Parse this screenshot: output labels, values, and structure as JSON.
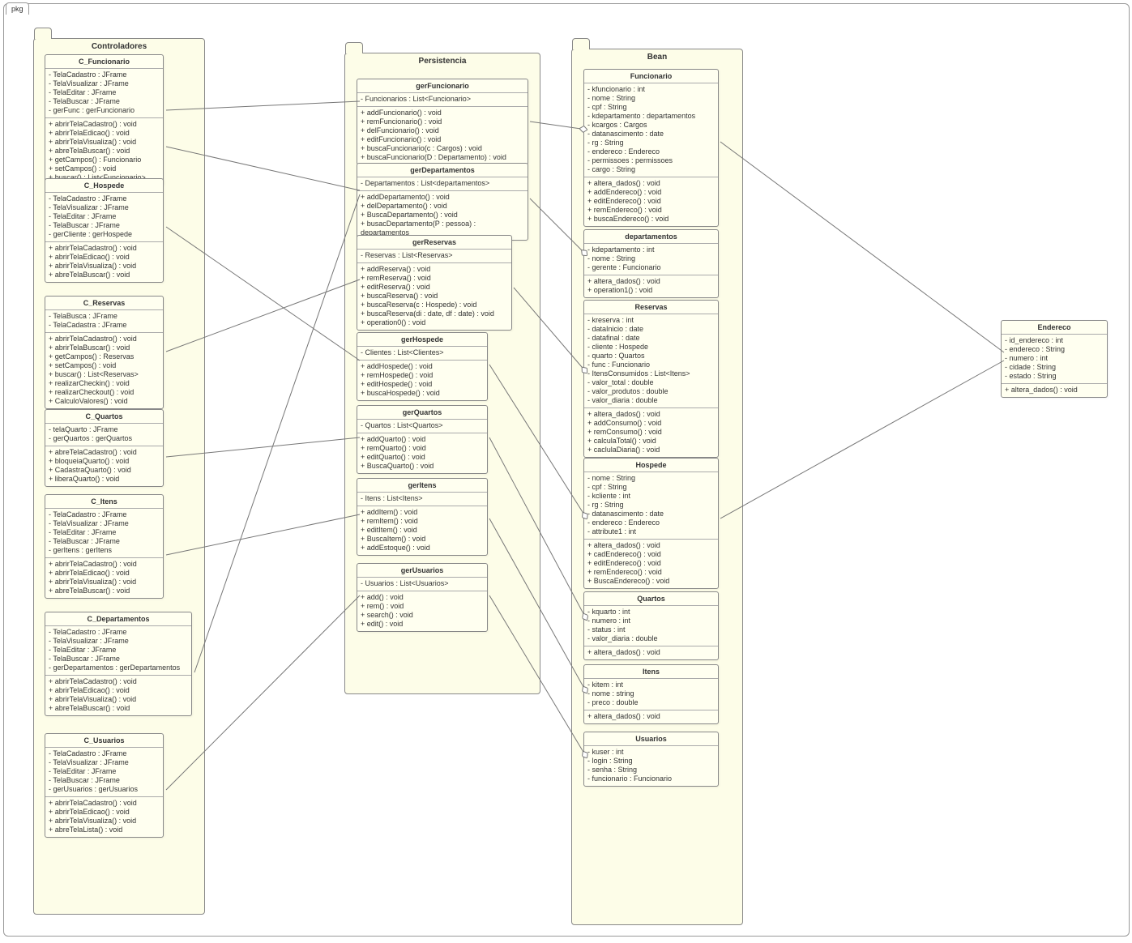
{
  "outer_package_label": "pkg",
  "packages": {
    "controladores": {
      "title": "Controladores"
    },
    "persistencia": {
      "title": "Persistencia"
    },
    "bean": {
      "title": "Bean"
    }
  },
  "classes": {
    "c_funcionario": {
      "name": "C_Funcionario",
      "attrs": [
        "- TelaCadastro : JFrame",
        "- TelaVisualizar : JFrame",
        "- TelaEditar : JFrame",
        "- TelaBuscar : JFrame",
        "- gerFunc : gerFuncionario"
      ],
      "ops": [
        "+ abrirTelaCadastro() : void",
        "+ abrirTelaEdicao() : void",
        "+ abrirTelaVisualiza() : void",
        "+ abreTelaBuscar() : void",
        "+ getCampos() : Funcionario",
        "+ setCampos() : void",
        "+ buscar() : List<Funcionario>"
      ]
    },
    "c_hospede": {
      "name": "C_Hospede",
      "attrs": [
        "- TelaCadastro : JFrame",
        "- TelaVisualizar : JFrame",
        "- TelaEditar : JFrame",
        "- TelaBuscar : JFrame",
        "- gerCliente : gerHospede"
      ],
      "ops": [
        "+ abrirTelaCadastro() : void",
        "+ abrirTelaEdicao() : void",
        "+ abrirTelaVisualiza() : void",
        "+ abreTelaBuscar() : void"
      ]
    },
    "c_reservas": {
      "name": "C_Reservas",
      "attrs": [
        "- TelaBusca : JFrame",
        "- TelaCadastra : JFrame"
      ],
      "ops": [
        "+ abrirTelaCadastro() : void",
        "+ abrirTelaBuscar() : void",
        "+ getCampos() : Reservas",
        "+ setCampos() : void",
        "+ buscar() : List<Reservas>",
        "+ realizarCheckin() : void",
        "+ realizarCheckout() : void",
        "+ CalculoValores() : void"
      ]
    },
    "c_quartos": {
      "name": "C_Quartos",
      "attrs": [
        "- telaQuarto : JFrame",
        "- gerQuartos : gerQuartos"
      ],
      "ops": [
        "+ abreTelaCadastro() : void",
        "+ bloqueiaQuarto() : void",
        "+ CadastraQuarto() : void",
        "+ liberaQuarto() : void"
      ]
    },
    "c_itens": {
      "name": "C_Itens",
      "attrs": [
        "- TelaCadastro : JFrame",
        "- TelaVisualizar : JFrame",
        "- TelaEditar : JFrame",
        "- TelaBuscar : JFrame",
        "- gerItens : gerItens"
      ],
      "ops": [
        "+ abrirTelaCadastro() : void",
        "+ abrirTelaEdicao() : void",
        "+ abrirTelaVisualiza() : void",
        "+ abreTelaBuscar() : void"
      ]
    },
    "c_departamentos": {
      "name": "C_Departamentos",
      "attrs": [
        "- TelaCadastro : JFrame",
        "- TelaVisualizar : JFrame",
        "- TelaEditar : JFrame",
        "- TelaBuscar : JFrame",
        "- gerDepartamentos : gerDepartamentos"
      ],
      "ops": [
        "+ abrirTelaCadastro() : void",
        "+ abrirTelaEdicao() : void",
        "+ abrirTelaVisualiza() : void",
        "+ abreTelaBuscar() : void"
      ]
    },
    "c_usuarios": {
      "name": "C_Usuarios",
      "attrs": [
        "- TelaCadastro : JFrame",
        "- TelaVisualizar : JFrame",
        "- TelaEditar : JFrame",
        "- TelaBuscar : JFrame",
        "- gerUsuarios : gerUsuarios"
      ],
      "ops": [
        "+ abrirTelaCadastro() : void",
        "+ abrirTelaEdicao() : void",
        "+ abrirTelaVisualiza() : void",
        "+ abreTelaLista() : void"
      ]
    },
    "ger_funcionario": {
      "name": "gerFuncionario",
      "attrs": [
        "- Funcionarios : List<Funcionario>"
      ],
      "ops": [
        "+ addFuncionario() : void",
        "+ remFuncionario() : void",
        "+ delFuncionario() : void",
        "+ editFuncionario() : void",
        "+ buscaFuncionario(c : Cargos) : void",
        "+ buscaFuncionario(D : Departamento) : void"
      ]
    },
    "ger_departamentos": {
      "name": "gerDepartamentos",
      "attrs": [
        "- Departamentos : List<departamentos>"
      ],
      "ops": [
        "+ addDepartamento() : void",
        "+ delDepartamento() : void",
        "+ BuscaDepartamento() : void",
        "+ busacDepartamento(P : pessoa) : departamentos"
      ]
    },
    "ger_reservas": {
      "name": "gerReservas",
      "attrs": [
        "- Reservas : List<Reservas>"
      ],
      "ops": [
        "+ addReserva() : void",
        "+ remReserva() : void",
        "+ editReserva() : void",
        "+ buscaReserva() : void",
        "+ buscaReserva(c : Hospede) : void",
        "+ buscaReserva(di : date, df : date) : void",
        "+ operation0() : void"
      ]
    },
    "ger_hospede": {
      "name": "gerHospede",
      "attrs": [
        "- Clientes : List<Clientes>"
      ],
      "ops": [
        "+ addHospede() : void",
        "+ remHospede() : void",
        "+ editHospede() : void",
        "+ buscaHospede() : void"
      ]
    },
    "ger_quartos": {
      "name": "gerQuartos",
      "attrs": [
        "- Quartos : List<Quartos>"
      ],
      "ops": [
        "+ addQuarto() : void",
        "+ remQuarto() : void",
        "+ editQuarto() : void",
        "+ BuscaQuarto() : void"
      ]
    },
    "ger_itens": {
      "name": "gerItens",
      "attrs": [
        "- Itens : List<Itens>"
      ],
      "ops": [
        "+ addItem() : void",
        "+ remItem() : void",
        "+ editItem() : void",
        "+ BuscaItem() : void",
        "+ addEstoque() : void"
      ]
    },
    "ger_usuarios": {
      "name": "gerUsuarios",
      "attrs": [
        "- Usuarios : List<Usuarios>"
      ],
      "ops": [
        "+ add() : void",
        "+ rem() : void",
        "+ search() : void",
        "+ edit() : void"
      ]
    },
    "funcionario": {
      "name": "Funcionario",
      "attrs": [
        "- kfuncionario : int",
        "- nome : String",
        "- cpf : String",
        "- kdepartamento : departamentos",
        "- kcargos : Cargos",
        "- datanascimento : date",
        "- rg : String",
        "- endereco : Endereco",
        "- permissoes : permissoes",
        "- cargo : String"
      ],
      "ops": [
        "+ altera_dados() : void",
        "+ addEndereco() : void",
        "+ editEndereco() : void",
        "+ remEndereco() : void",
        "+ buscaEndereco() : void"
      ]
    },
    "departamentos_b": {
      "name": "departamentos",
      "attrs": [
        "- kdepartamento : int",
        "- nome : String",
        "- gerente : Funcionario"
      ],
      "ops": [
        "+ altera_dados() : void",
        "+ operation1() : void"
      ]
    },
    "reservas_b": {
      "name": "Reservas",
      "attrs": [
        "- kreserva : int",
        "- dataInicio : date",
        "- datafinal : date",
        "- cliente : Hospede",
        "- quarto : Quartos",
        "- func : Funcionario",
        "- ItensConsumidos : List<Itens>",
        "- valor_total : double",
        "- valor_produtos : double",
        "- valor_diaria : double"
      ],
      "ops": [
        "+ altera_dados() : void",
        "+ addConsumo() : void",
        "+ remConsumo() : void",
        "+ calculaTotal() : void",
        "+ caclulaDiaria() : void"
      ]
    },
    "hospede_b": {
      "name": "Hospede",
      "attrs": [
        "- nome : String",
        "- cpf : String",
        "- kcliente : int",
        "- rg : String",
        "- datanascimento : date",
        "- endereco : Endereco",
        "- attribute1 : int"
      ],
      "ops": [
        "+ altera_dados() : void",
        "+ cadEndereco() : void",
        "+ editEndereco() : void",
        "+ remEndereco() : void",
        "+ BuscaEndereco() : void"
      ]
    },
    "quartos_b": {
      "name": "Quartos",
      "attrs": [
        "- kquarto : int",
        "- numero : int",
        "- status : int",
        "- valor_diaria : double"
      ],
      "ops": [
        "+ altera_dados() : void"
      ]
    },
    "itens_b": {
      "name": "Itens",
      "attrs": [
        "- kitem : int",
        "- nome : string",
        "- preco : double"
      ],
      "ops": [
        "+ altera_dados() : void"
      ]
    },
    "usuarios_b": {
      "name": "Usuarios",
      "attrs": [
        "- kuser : int",
        "- login : String",
        "- senha : String",
        "- funcionario : Funcionario"
      ]
    },
    "endereco": {
      "name": "Endereco",
      "attrs": [
        "- id_endereco : int",
        "- endereco : String",
        "- numero : int",
        "- cidade : String",
        "- estado : String"
      ],
      "ops": [
        "+ altera_dados() : void"
      ]
    }
  }
}
